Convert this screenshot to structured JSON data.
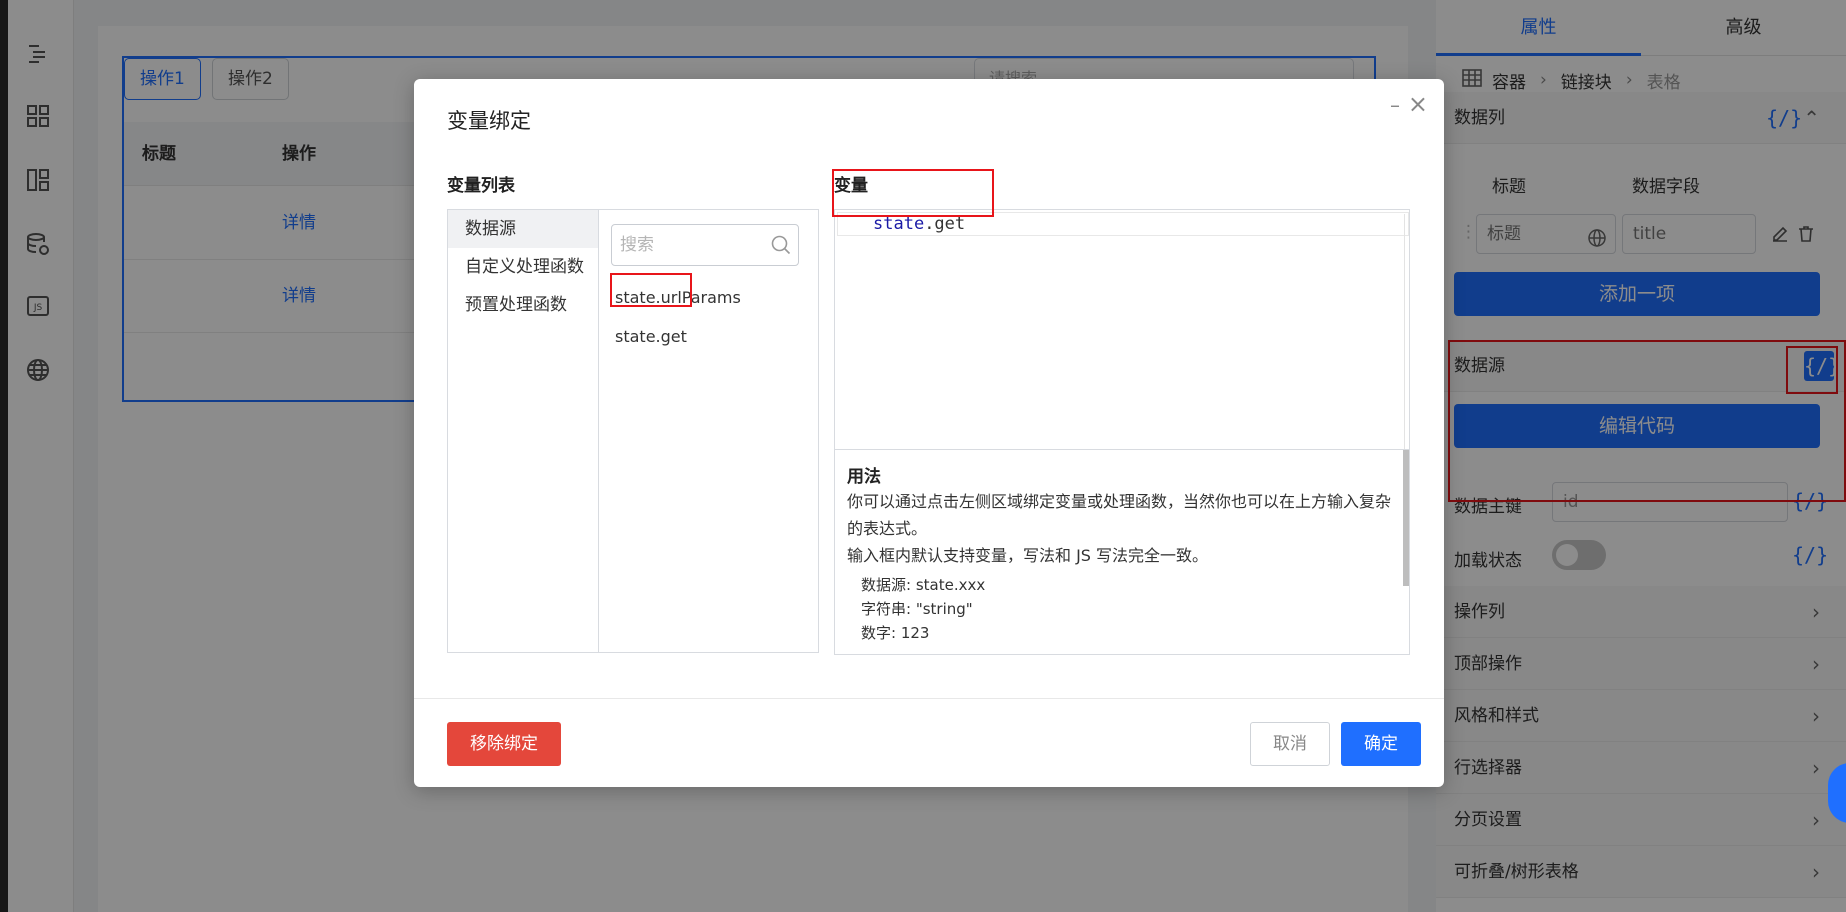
{
  "left_rail": {
    "icons": [
      "outline-icon",
      "components-icon",
      "layout-icon",
      "database-icon",
      "js-icon",
      "globe-icon"
    ],
    "js_label": "JS"
  },
  "canvas": {
    "toolbar": {
      "button1": "操作1",
      "button2": "操作2",
      "search_placeholder": "请搜索"
    },
    "table": {
      "columns": [
        "标题",
        "操作"
      ],
      "rows": [
        {
          "action": "详情"
        },
        {
          "action": "详情"
        }
      ]
    }
  },
  "right_panel": {
    "tabs": [
      "属性",
      "高级"
    ],
    "breadcrumb": [
      "容器",
      "链接块",
      "表格"
    ],
    "data_columns": {
      "label": "数据列",
      "code_icon": "{/}",
      "col_headers": [
        "标题",
        "数据字段"
      ],
      "row": {
        "title": "标题",
        "field": "title"
      },
      "add_button": "添加一项"
    },
    "data_source": {
      "label": "数据源",
      "code_icon": "{/}",
      "edit_button": "编辑代码"
    },
    "primary_key": {
      "label": "数据主键",
      "value": "id",
      "code_icon": "{/}"
    },
    "loading": {
      "label": "加载状态",
      "code_icon": "{/}"
    },
    "sections": [
      "操作列",
      "顶部操作",
      "风格和样式",
      "行选择器",
      "分页设置",
      "可折叠/树形表格"
    ]
  },
  "modal": {
    "title": "变量绑定",
    "list_title": "变量列表",
    "categories": [
      "数据源",
      "自定义处理函数",
      "预置处理函数"
    ],
    "search_placeholder": "搜索",
    "variables": [
      "state.urlParams",
      "state.get"
    ],
    "editor_title": "变量",
    "editor": {
      "obj": "state",
      "rest": ".get"
    },
    "usage": {
      "title": "用法",
      "p1": "你可以通过点击左侧区域绑定变量或处理函数，当然你也可以在上方输入复杂的表达式。",
      "p2": "输入框内默认支持变量，写法和 JS 写法完全一致。",
      "examples": [
        "数据源: state.xxx",
        "字符串: \"string\"",
        "数字: 123"
      ]
    },
    "buttons": {
      "remove": "移除绑定",
      "cancel": "取消",
      "ok": "确定"
    },
    "minimize_glyph": "–",
    "close_glyph": "×"
  },
  "colors": {
    "primary": "#1f6fff",
    "danger": "#e4473b",
    "highlight_box": "#e8151a"
  }
}
